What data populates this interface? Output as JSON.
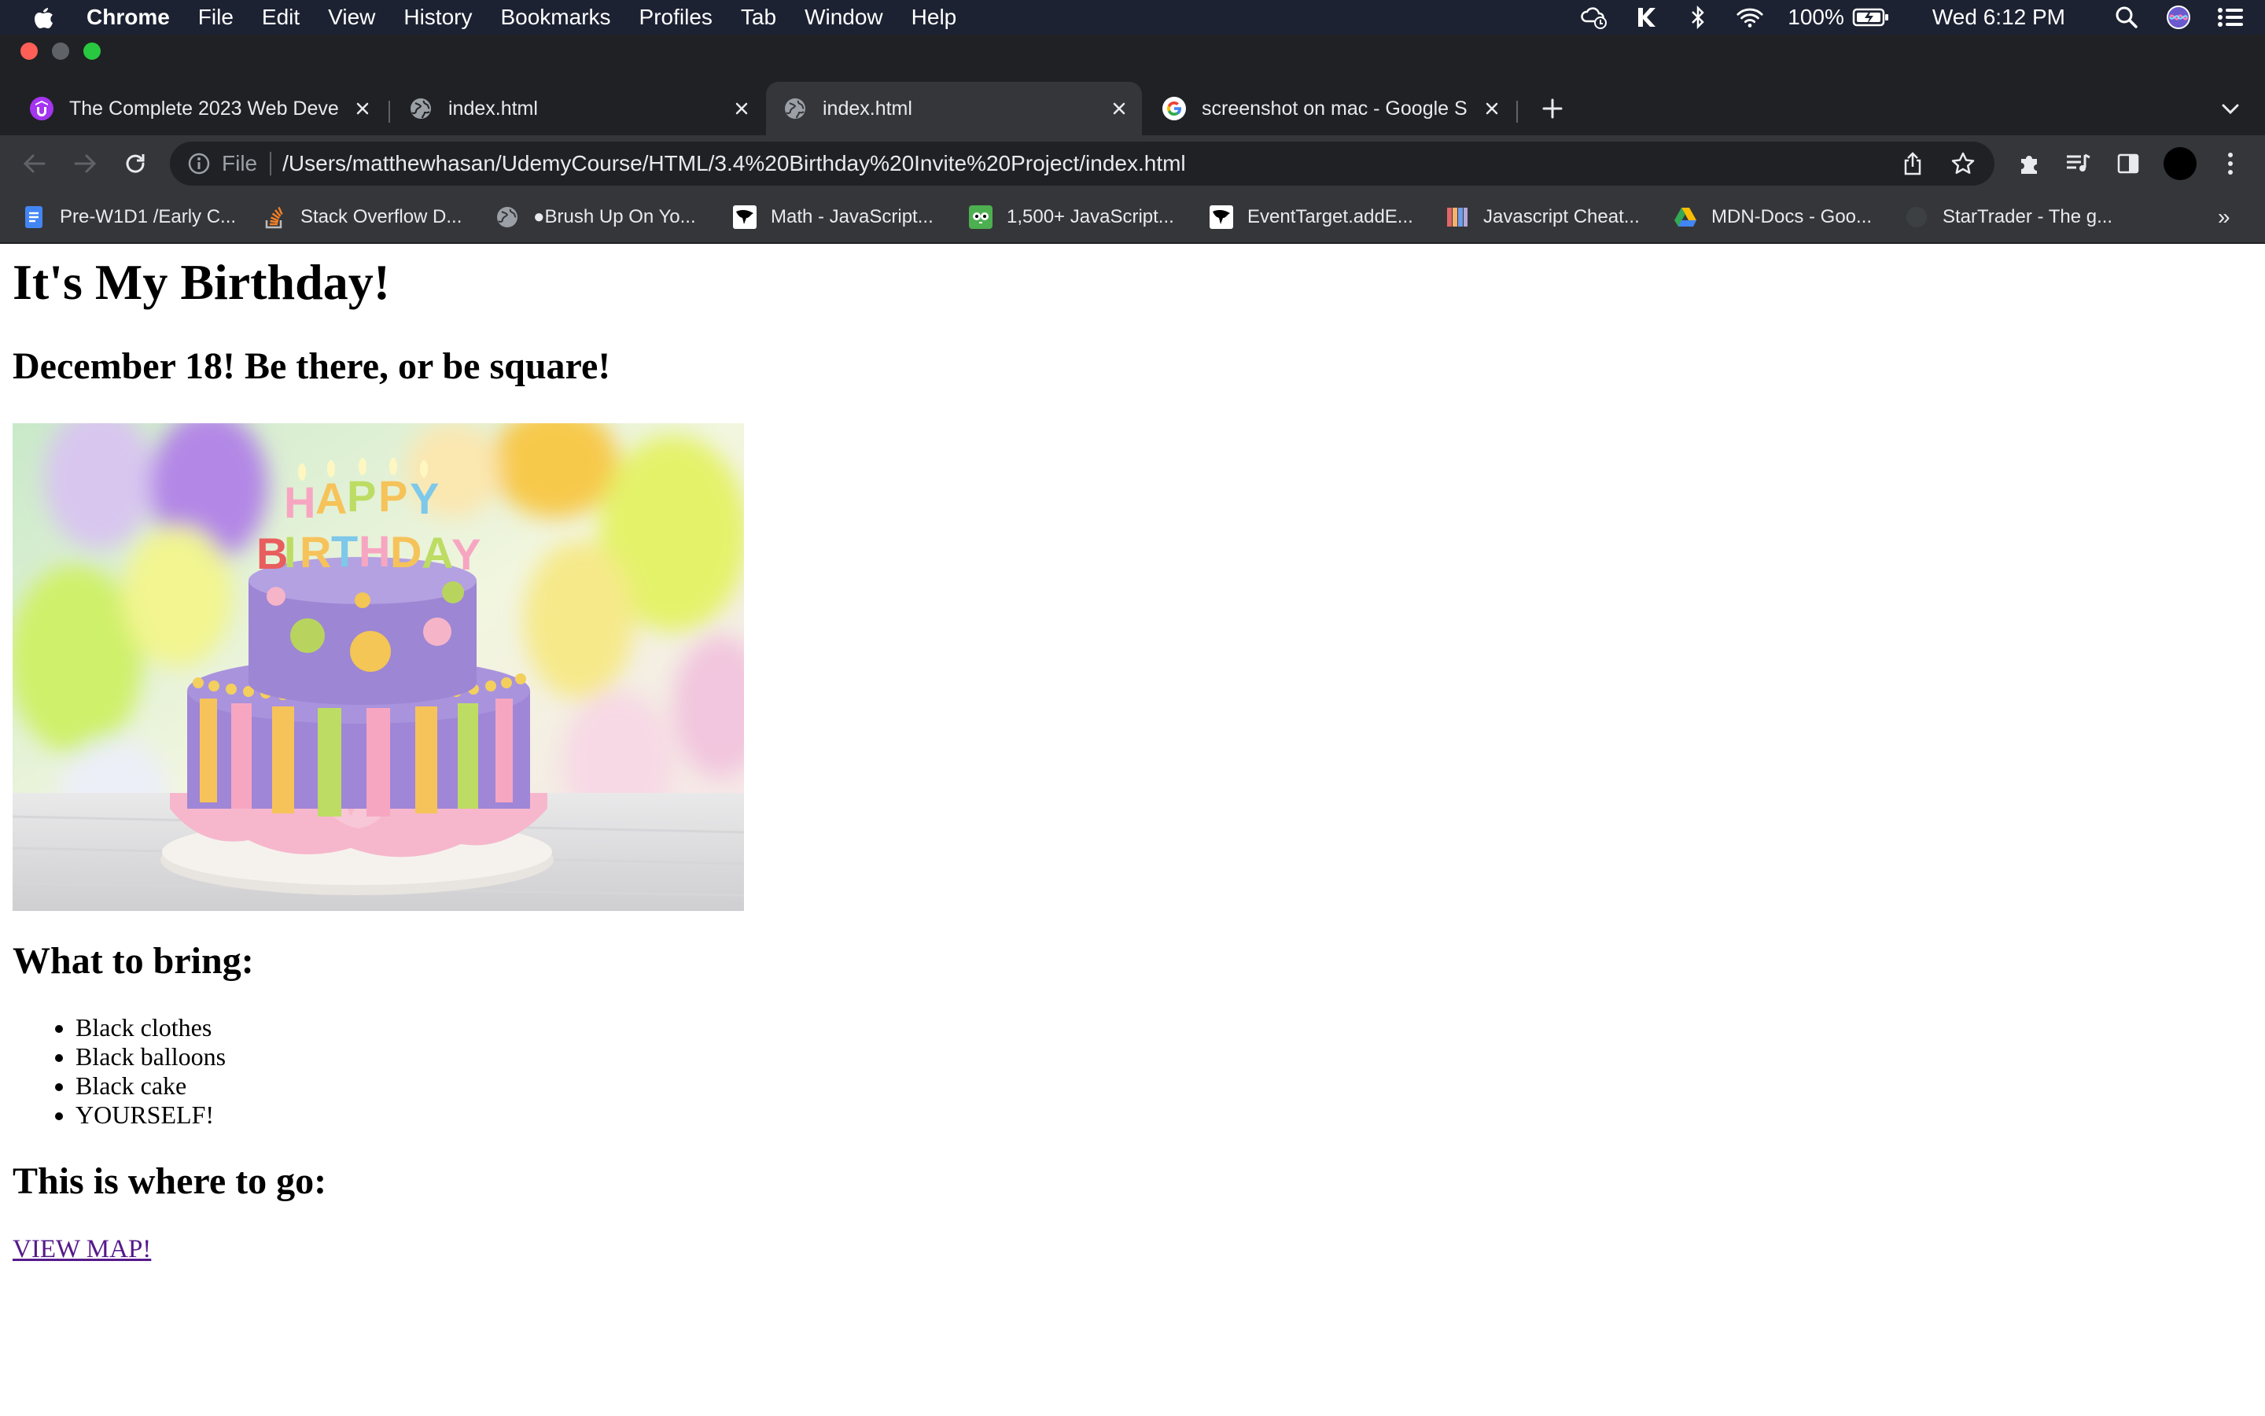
{
  "menubar": {
    "app": "Chrome",
    "items": [
      "File",
      "Edit",
      "View",
      "History",
      "Bookmarks",
      "Profiles",
      "Tab",
      "Window",
      "Help"
    ],
    "battery": "100%",
    "clock": "Wed 6:12 PM"
  },
  "tabs": [
    {
      "title": "The Complete 2023 Web Deve",
      "favicon": "udemy-icon",
      "active": false
    },
    {
      "title": "index.html",
      "favicon": "globe-icon",
      "active": false
    },
    {
      "title": "index.html",
      "favicon": "globe-icon",
      "active": true
    },
    {
      "title": "screenshot on mac - Google S",
      "favicon": "google-icon",
      "active": false
    }
  ],
  "toolbar": {
    "scheme_label": "File",
    "url": "/Users/matthewhasan/UdemyCourse/HTML/3.4%20Birthday%20Invite%20Project/index.html"
  },
  "bookmarks": [
    {
      "label": "Pre-W1D1 /Early C...",
      "icon": "docs-icon",
      "color": "#4285f4"
    },
    {
      "label": "Stack Overflow D...",
      "icon": "stackoverflow-icon",
      "color": "#f48024"
    },
    {
      "label": "●Brush Up On Yo...",
      "icon": "globe-icon",
      "color": "#9aa0a6"
    },
    {
      "label": "Math - JavaScript...",
      "icon": "mdn-icon",
      "color": "#000000"
    },
    {
      "label": "1,500+ JavaScript...",
      "icon": "owl-icon",
      "color": "#4caf50"
    },
    {
      "label": "EventTarget.addE...",
      "icon": "mdn-icon",
      "color": "#000000"
    },
    {
      "label": "Javascript Cheat...",
      "icon": "cheatsheet-icon",
      "color": "#e06666"
    },
    {
      "label": "MDN-Docs - Goo...",
      "icon": "drive-icon",
      "color": "#fbbc04"
    },
    {
      "label": "StarTrader - The g...",
      "icon": "startrader-icon",
      "color": "#35363a"
    }
  ],
  "page": {
    "heading": "It's My Birthday!",
    "subheading": "December 18! Be there, or be square!",
    "image_alt": "birthday cake",
    "cake_lettering": "HAPPY BIRTHDAY",
    "bring_heading": "What to bring:",
    "bring_items": [
      "Black clothes",
      "Black balloons",
      "Black cake",
      "YOURSELF!"
    ],
    "go_heading": "This is where to go:",
    "map_link": "VIEW MAP!"
  }
}
